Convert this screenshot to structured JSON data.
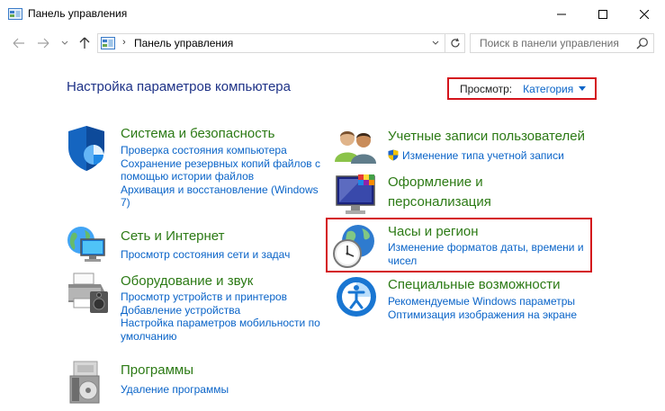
{
  "window": {
    "title": "Панель управления"
  },
  "address": {
    "path": "Панель управления",
    "separator": "›"
  },
  "search": {
    "placeholder": "Поиск в панели управления"
  },
  "heading": "Настройка параметров компьютера",
  "view_by": {
    "label": "Просмотр:",
    "value": "Категория"
  },
  "categories": {
    "system": {
      "title": "Система и безопасность",
      "links": [
        "Проверка состояния компьютера",
        "Сохранение резервных копий файлов с",
        "помощью истории файлов",
        "Архивация и восстановление (Windows",
        "7)"
      ]
    },
    "network": {
      "title": "Сеть и Интернет",
      "links": [
        "Просмотр состояния сети и задач"
      ]
    },
    "hardware": {
      "title": "Оборудование и звук",
      "links": [
        "Просмотр устройств и принтеров",
        "Добавление устройства",
        "Настройка параметров мобильности по",
        "умолчанию"
      ]
    },
    "programs": {
      "title": "Программы",
      "links": [
        "Удаление программы"
      ]
    },
    "accounts": {
      "title": "Учетные записи пользователей",
      "links": [
        "Изменение типа учетной записи"
      ]
    },
    "appearance": {
      "title": [
        "Оформление и",
        "персонализация"
      ]
    },
    "clock": {
      "title": "Часы и регион",
      "links": [
        "Изменение форматов даты, времени и",
        "чисел"
      ]
    },
    "ease": {
      "title": "Специальные возможности",
      "links": [
        "Рекомендуемые Windows параметры",
        "Оптимизация изображения на экране"
      ]
    }
  },
  "colors": {
    "title_green": "#2c7a15",
    "link_blue": "#0a64c8",
    "heading_blue": "#1e3287",
    "highlight_red": "#d4141c"
  }
}
